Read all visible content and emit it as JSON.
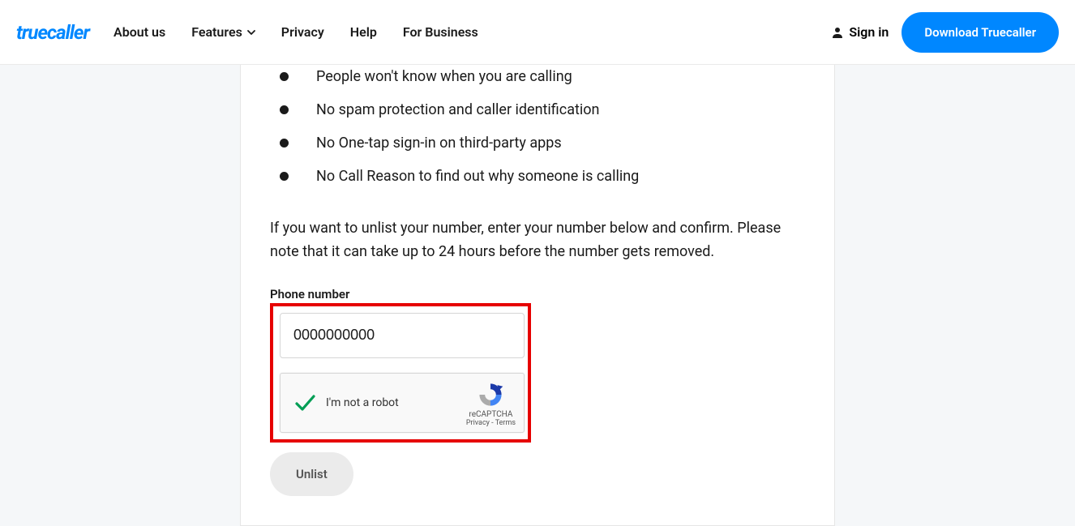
{
  "header": {
    "logo": "truecaller",
    "nav": {
      "about": "About us",
      "features": "Features",
      "privacy": "Privacy",
      "help": "Help",
      "business": "For Business"
    },
    "signin": "Sign in",
    "download": "Download Truecaller"
  },
  "bullets": {
    "b1": "People won't know when you are calling",
    "b2": "No spam protection and caller identification",
    "b3": "No One-tap sign-in on third-party apps",
    "b4": "No Call Reason to find out why someone is calling"
  },
  "paragraph": "If you want to unlist your number, enter your number below and confirm. Please note that it can take up to 24 hours before the number gets removed.",
  "phone": {
    "label": "Phone number",
    "value": "0000000000"
  },
  "recaptcha": {
    "text": "I'm not a robot",
    "brand": "reCAPTCHA",
    "privacy": "Privacy",
    "terms": "Terms"
  },
  "unlist": "Unlist"
}
